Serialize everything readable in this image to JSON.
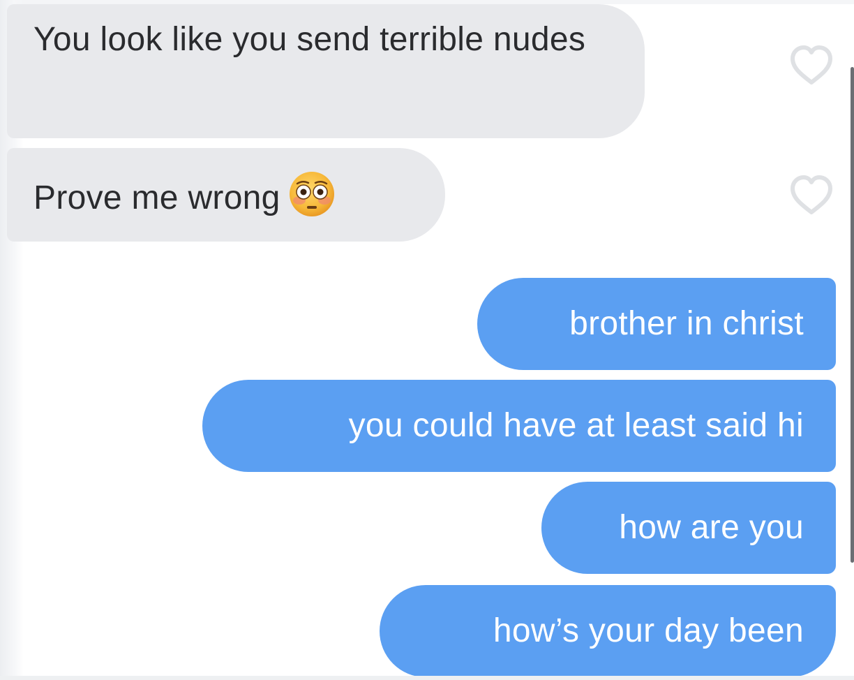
{
  "conversation": {
    "messages": [
      {
        "direction": "received",
        "text": "You look like you send terrible nudes"
      },
      {
        "direction": "received",
        "text": "Prove me wrong",
        "emoji": "flushed-face-emoji"
      },
      {
        "direction": "sent",
        "text": "brother in christ"
      },
      {
        "direction": "sent",
        "text": "you could have at least said hi"
      },
      {
        "direction": "sent",
        "text": "how are you"
      },
      {
        "direction": "sent",
        "text": "how’s your day been"
      }
    ]
  },
  "icons": {
    "like": "heart-outline-icon",
    "emoji": "flushed-face-emoji"
  },
  "colors": {
    "received_bubble": "#e8e9ec",
    "received_text": "#2a2b2e",
    "sent_bubble": "#5b9ff2",
    "sent_text": "#ffffff",
    "heart_outline": "#dfe1e4"
  }
}
